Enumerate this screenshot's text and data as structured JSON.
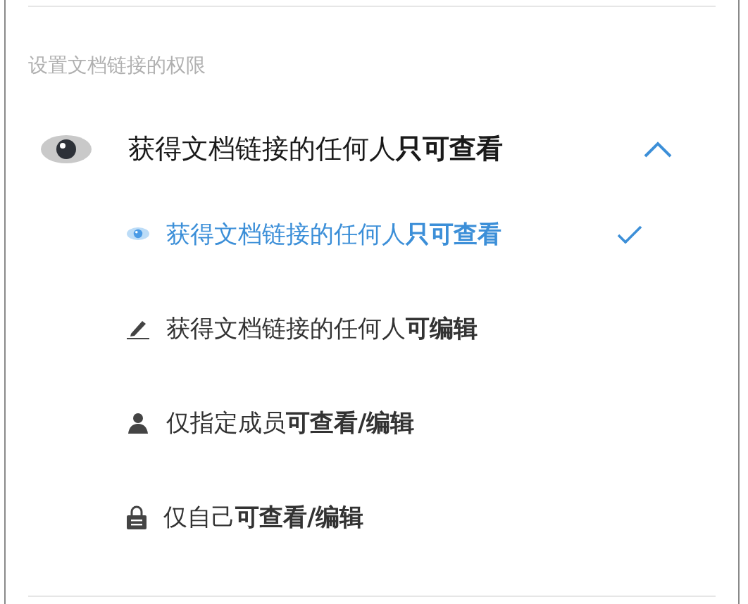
{
  "section_label": "设置文档链接的权限",
  "dropdown": {
    "kind": "view",
    "label": "获得文档链接的任何人**只可查看**",
    "expanded": true
  },
  "options": [
    {
      "kind": "view",
      "label": "获得文档链接的任何人**只可查看**",
      "selected": true
    },
    {
      "kind": "edit",
      "label": "获得文档链接的任何人**可编辑**",
      "selected": false
    },
    {
      "kind": "member",
      "label": "仅指定成员**可查看/编辑**",
      "selected": false
    },
    {
      "kind": "private",
      "label": "仅自己**可查看/编辑**",
      "selected": false
    }
  ]
}
